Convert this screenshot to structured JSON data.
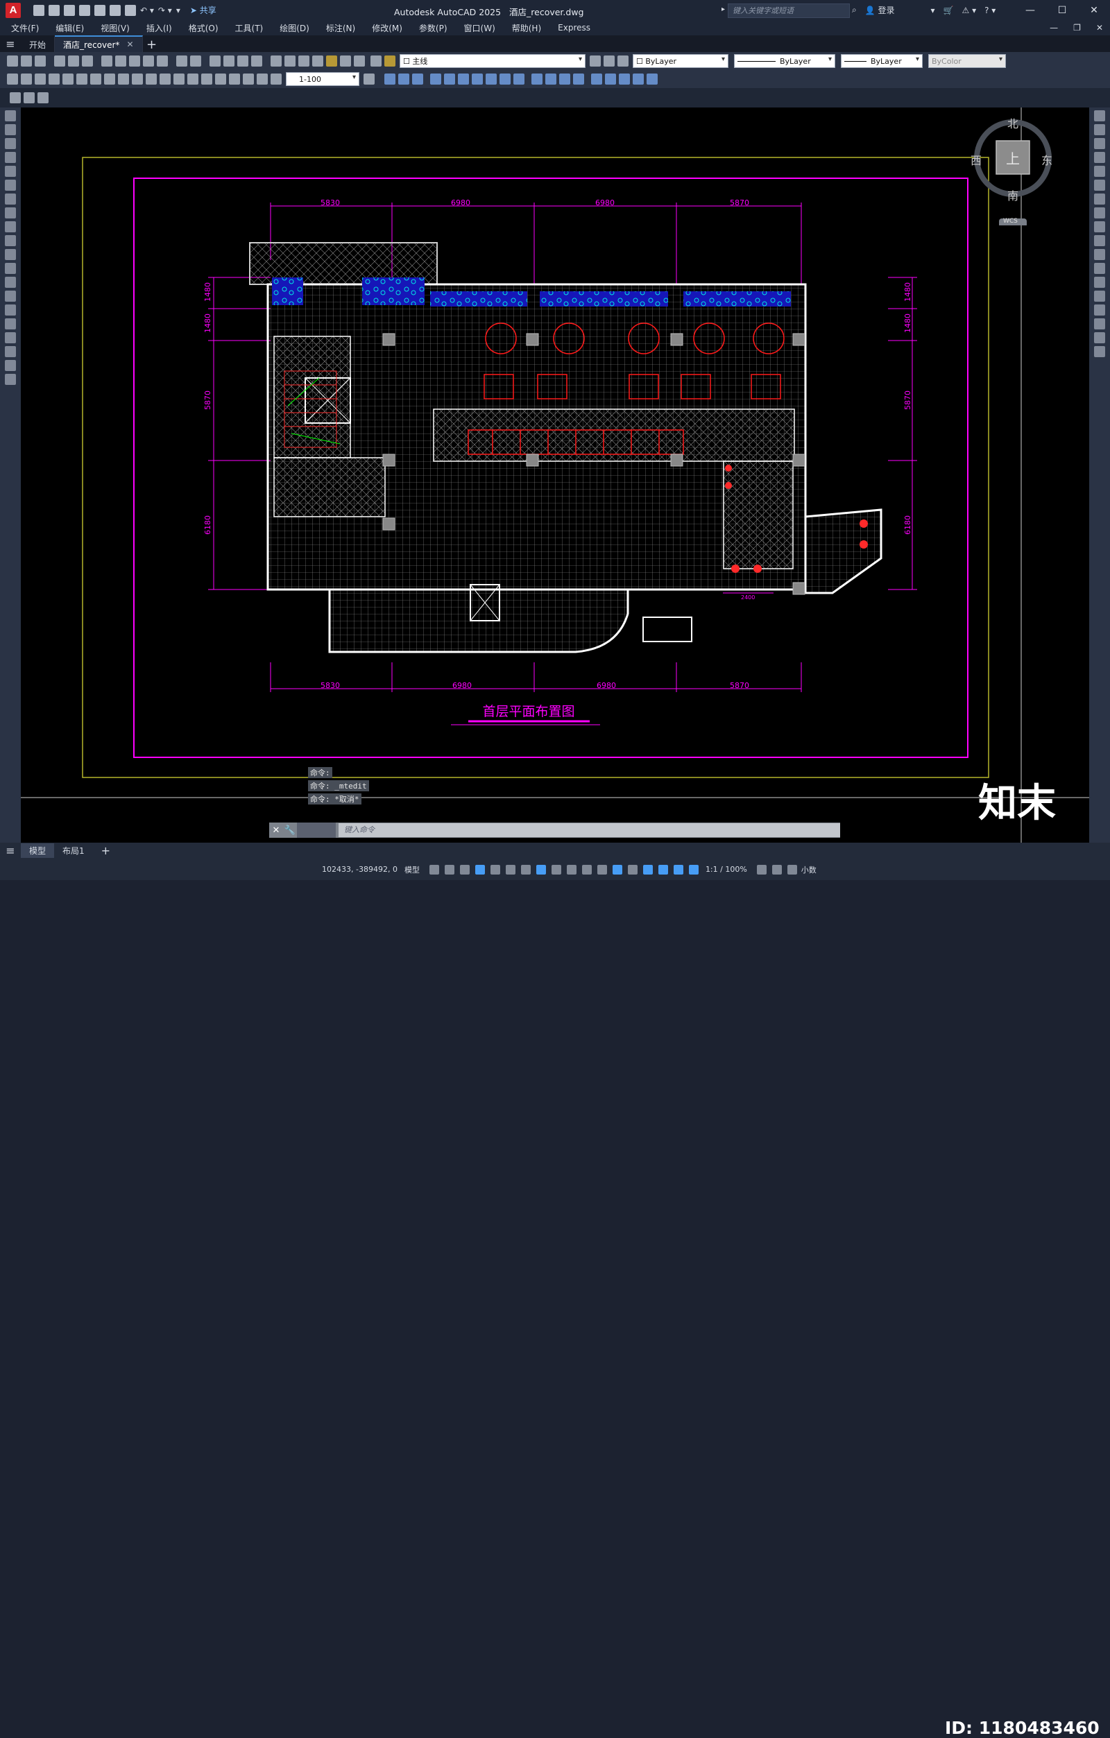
{
  "app": {
    "title": "Autodesk AutoCAD 2025",
    "filename": "酒店_recover.dwg",
    "logo": "A",
    "share_label": "共享",
    "search_placeholder": "键入关键字或短语",
    "login_label": "登录",
    "accent": "#3f8ed8"
  },
  "menu": [
    "文件(F)",
    "编辑(E)",
    "视图(V)",
    "插入(I)",
    "格式(O)",
    "工具(T)",
    "绘图(D)",
    "标注(N)",
    "修改(M)",
    "参数(P)",
    "窗口(W)",
    "帮助(H)",
    "Express"
  ],
  "file_tabs": {
    "start": "开始",
    "active": "酒店_recover*"
  },
  "properties": {
    "layer": "主线",
    "color": "ByLayer",
    "linetype": "ByLayer",
    "lineweight": "ByLayer",
    "plotstyle": "ByColor",
    "scale": "1-100"
  },
  "viewcube": {
    "north": "北",
    "south": "南",
    "east": "东",
    "west": "西",
    "top": "上",
    "wcs": "WCS"
  },
  "drawing": {
    "title": "首层平面布置图",
    "dims_top": [
      "5830",
      "6980",
      "6980",
      "5870"
    ],
    "dims_bottom": [
      "5830",
      "6980",
      "6980",
      "5870"
    ],
    "dims_left": [
      "1480",
      "1480",
      "5870",
      "6180"
    ],
    "dims_right": [
      "1480",
      "1480",
      "5870",
      "6180"
    ],
    "dim_small": "2400"
  },
  "command": {
    "history": [
      "命令:",
      "命令: _mtedit",
      "命令: *取消*"
    ],
    "placeholder": "键入命令"
  },
  "layout_tabs": [
    "模型",
    "布局1"
  ],
  "status": {
    "coords": "102433, -389492, 0",
    "space": "模型",
    "annoscale": "1:1 / 100%",
    "units": "小数"
  },
  "watermark": {
    "brand": "知末",
    "id": "ID: 1180483460"
  }
}
